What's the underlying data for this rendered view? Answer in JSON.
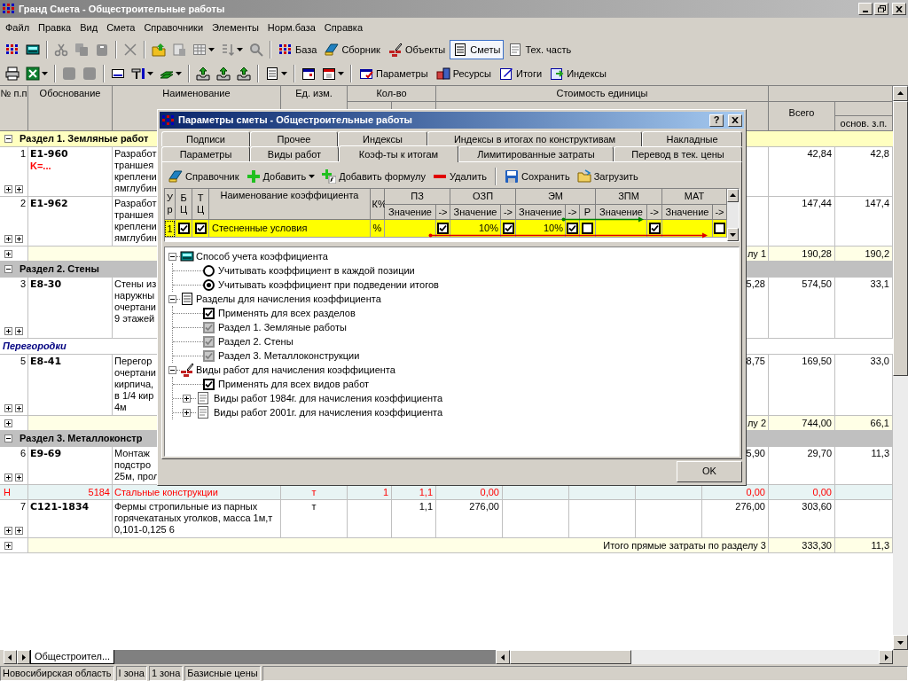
{
  "window": {
    "title": "Гранд Смета - Общестроительные работы"
  },
  "menu": [
    "Файл",
    "Правка",
    "Вид",
    "Смета",
    "Справочники",
    "Элементы",
    "Норм.база",
    "Справка"
  ],
  "toolbar_1": [
    {
      "label": "База",
      "pressed": false
    },
    {
      "label": "Сборник",
      "pressed": false
    },
    {
      "label": "Объекты",
      "pressed": false
    },
    {
      "label": "Сметы",
      "pressed": true
    },
    {
      "label": "Тех. часть",
      "pressed": false
    }
  ],
  "toolbar_2": [
    {
      "label": "Параметры"
    },
    {
      "label": "Ресурсы"
    },
    {
      "label": "Итоги"
    },
    {
      "label": "Индексы"
    }
  ],
  "table": {
    "columns": {
      "number": "№ п.п",
      "code": "Обоснование",
      "name": "Наименование",
      "unit": "Ед. изм.",
      "quantity": "Кол-во",
      "unit_cost": "Стоимость единицы",
      "total": "Всего",
      "base_salary": "основ. з.п."
    },
    "rows": [
      {
        "kind": "section",
        "title": "Раздел 1. Земляные работ",
        "selected": true,
        "expanded": true
      },
      {
        "kind": "item",
        "number": "1",
        "code": "E1-960",
        "note": "K=...",
        "name": "Разработ\nтраншея\nкреплени\nямглубин",
        "total": "42,84",
        "base_salary": "42,8"
      },
      {
        "kind": "item",
        "number": "2",
        "code": "E1-962",
        "name": "Разработ\nтраншея\nкреплени\nямглубин",
        "total": "147,44",
        "base_salary": "147,4"
      },
      {
        "kind": "subtotal",
        "label": "лу 1",
        "total": "190,28",
        "base_salary": "190,2"
      },
      {
        "kind": "section",
        "title": "Раздел 2. Стены",
        "selected": false,
        "expanded": true
      },
      {
        "kind": "item",
        "number": "3",
        "code": "E8-30",
        "name": "Стены из\nнаружны\nочертани\n9 этажей",
        "cost_5": "5,28",
        "total": "574,50",
        "base_salary": "33,1"
      },
      {
        "kind": "group",
        "title": "Перегородки"
      },
      {
        "kind": "item",
        "number": "5",
        "code": "E8-41",
        "name": "Перегор\nочертани\nкирпича,\nв 1/4 кир\n4м",
        "cost_5": "8,75",
        "total": "169,50",
        "base_salary": "33,0"
      },
      {
        "kind": "subtotal",
        "label": "лу 2",
        "total": "744,00",
        "base_salary": "66,1"
      },
      {
        "kind": "section",
        "title": "Раздел 3. Металлоконстр",
        "selected": false,
        "expanded": true
      },
      {
        "kind": "item",
        "number": "6",
        "code": "E9-69",
        "name": "Монтаж\nподстро\n25м, прол",
        "cost_5": "5,90",
        "total": "29,70",
        "base_salary": "11,3"
      },
      {
        "kind": "resource",
        "type_mark": "Н",
        "code": "5184",
        "name": "Стальные конструкции",
        "unit": "т",
        "quantity": "1",
        "quantity_total": "1,1",
        "cost_1": "0,00",
        "cost_5": "0,00",
        "total": "0,00"
      },
      {
        "kind": "item",
        "number": "7",
        "code": "С121-1834",
        "name": "Фермы стропильные из парных\nгорячекатаных уголков, масса 1м,т\n0,101-0,125 6",
        "unit": "т",
        "quantity_total": "1,1",
        "cost_1": "276,00",
        "cost_5": "276,00",
        "total": "303,60"
      },
      {
        "kind": "subtotal",
        "label": "Итого прямые затраты по разделу 3",
        "total": "333,30",
        "base_salary": "11,3"
      }
    ]
  },
  "sheet_tab": "Общестроител...",
  "status_bar": [
    "Новосибирская область",
    "I зона",
    "1 зона",
    "Базисные цены"
  ],
  "dialog": {
    "title": "Параметры сметы - Общестроительные работы",
    "help": "?",
    "tab_rows": [
      [
        {
          "label": "Подписи",
          "selected": false
        },
        {
          "label": "Прочее",
          "selected": false
        },
        {
          "label": "Индексы",
          "selected": false
        },
        {
          "label": "Индексы в итогах по конструктивам",
          "selected": false
        },
        {
          "label": "Накладные",
          "selected": false
        }
      ],
      [
        {
          "label": "Параметры",
          "selected": false
        },
        {
          "label": "Виды работ",
          "selected": false
        },
        {
          "label": "Коэф-ты к итогам",
          "selected": true
        },
        {
          "label": "Лимитированные затраты",
          "selected": false
        },
        {
          "label": "Перевод в тек. цены",
          "selected": false
        }
      ]
    ],
    "toolbar": [
      {
        "label": "Справочник",
        "dropdown": false
      },
      {
        "label": "Добавить",
        "dropdown": true
      },
      {
        "label": "Добавить формулу",
        "dropdown": false
      },
      {
        "label": "Удалить",
        "dropdown": false
      },
      {
        "label": "Сохранить",
        "dropdown": false
      },
      {
        "label": "Загрузить",
        "dropdown": false
      }
    ],
    "grid": {
      "columns": {
        "level": "Ур",
        "bc": "БЦ",
        "tc": "ТЦ",
        "name": "Наименование коэффициента",
        "percent": "К%"
      },
      "groups": [
        {
          "title": "ПЗ",
          "value_header": "Значение",
          "arrow_header": "->"
        },
        {
          "title": "ОЗП",
          "value_header": "Значение",
          "arrow_header": "->"
        },
        {
          "title": "ЭМ",
          "value_header": "Значение",
          "arrow_header": "->",
          "r_header": "Р"
        },
        {
          "title": "ЗПМ",
          "value_header": "Значение",
          "arrow_header": "->"
        },
        {
          "title": "МАТ",
          "value_header": "Значение",
          "arrow_header": "->"
        }
      ],
      "rows": [
        {
          "level": "1",
          "bc": true,
          "tc": true,
          "name": "Стесненные условия",
          "percent": "%",
          "cells": [
            {
              "arrow": true
            },
            {
              "value": "10%",
              "arrow": true
            },
            {
              "value": "10%",
              "arrow": true,
              "r": false
            },
            {
              "arrow": true
            },
            {
              "arrow": false
            }
          ]
        }
      ]
    },
    "tree": [
      {
        "label": "Способ учета коэффициента",
        "expanded": true,
        "children": [
          {
            "kind": "radio",
            "label": "Учитывать коэффициент в каждой позиции",
            "selected": false
          },
          {
            "kind": "radio",
            "label": "Учитывать коэффициент при подведении итогов",
            "selected": true
          }
        ]
      },
      {
        "label": "Разделы для начисления коэффициента",
        "expanded": true,
        "children": [
          {
            "kind": "checkbox",
            "label": "Применять для всех разделов",
            "checked": true,
            "disabled": false
          },
          {
            "kind": "checkbox",
            "label": "Раздел 1. Земляные работы",
            "checked": true,
            "disabled": true
          },
          {
            "kind": "checkbox",
            "label": "Раздел 2. Стены",
            "checked": true,
            "disabled": true
          },
          {
            "kind": "checkbox",
            "label": "Раздел 3. Металлоконструкции",
            "checked": true,
            "disabled": true
          }
        ]
      },
      {
        "label": "Виды работ для начисления коэффициента",
        "expanded": true,
        "children": [
          {
            "kind": "checkbox",
            "label": "Применять для всех видов работ",
            "checked": true,
            "disabled": false
          },
          {
            "kind": "folder",
            "label": "Виды работ 1984г. для начисления коэффициента",
            "expanded": false
          },
          {
            "kind": "folder",
            "label": "Виды работ 2001г. для начисления коэффициента",
            "expanded": false
          }
        ]
      }
    ],
    "ok_button": "OK"
  }
}
